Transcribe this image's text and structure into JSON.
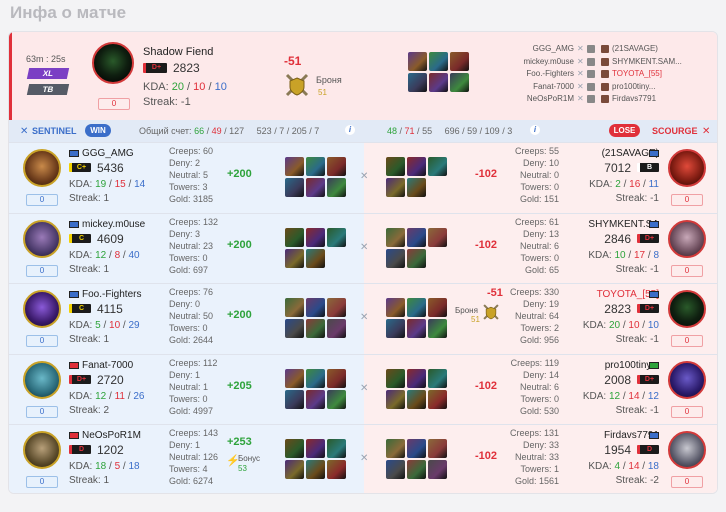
{
  "title": "Инфа о матче",
  "header": {
    "duration": "63m : 25s",
    "tag_xl": "XL",
    "tag_tb": "TB",
    "hero": "Shadow Fiend",
    "rank_badge": "D+",
    "mmr": "2823",
    "kda_label": "KDA:",
    "kda": [
      "20",
      "10",
      "10"
    ],
    "streak": "Streak: -1",
    "zero_badge": "0",
    "delta": "-51",
    "armor_label": "Броня",
    "armor_value": "51",
    "players_left": [
      "GGG_AMG",
      "mickey.m0use",
      "Foo.-Fighters",
      "Fanat-7000",
      "NeOsPoR1M"
    ],
    "players_right": [
      "(21SAVAGE)",
      "SHYMKENT.SAM...",
      "TOYOTA_[55]",
      "pro100tiny...",
      "Firdavs7791"
    ]
  },
  "summary": {
    "sentinel_label": "SENTINEL",
    "win_label": "WIN",
    "total_label": "Общий счет:",
    "left_kda": [
      "66",
      "49",
      "127"
    ],
    "left_totals": [
      "523",
      "7",
      "205",
      "7"
    ],
    "right_kda": [
      "48",
      "71",
      "55"
    ],
    "right_totals": [
      "696",
      "59",
      "109",
      "3"
    ],
    "lose_label": "LOSE",
    "scourge_label": "SCOURGE",
    "info_glyph": "i"
  },
  "rows": [
    {
      "left": {
        "name": "GGG_AMG",
        "rank": "C+",
        "mmr": "5436",
        "kda": [
          "19",
          "15",
          "14"
        ],
        "streak": "Streak: 1",
        "badge": "0",
        "stats": [
          "Creeps: 60",
          "Deny: 2",
          "Neutral: 5",
          "Towers: 3",
          "Gold: 3185"
        ],
        "delta": "+200"
      },
      "right": {
        "name": "(21SAVAGE)",
        "rank": "B",
        "mmr": "7012",
        "kda": [
          "2",
          "16",
          "11"
        ],
        "streak": "Streak: -1",
        "badge": "0",
        "stats": [
          "Creeps: 55",
          "Deny: 10",
          "Neutral: 0",
          "Towers: 0",
          "Gold: 151"
        ],
        "delta": "-102"
      }
    },
    {
      "left": {
        "name": "mickey.m0use",
        "rank": "C",
        "mmr": "4609",
        "kda": [
          "12",
          "8",
          "40"
        ],
        "streak": "Streak: 1",
        "badge": "0",
        "stats": [
          "Creeps: 132",
          "Deny: 3",
          "Neutral: 23",
          "Towers: 0",
          "Gold: 697"
        ],
        "delta": "+200"
      },
      "right": {
        "name": "SHYMKENT.SA",
        "rank": "D+",
        "mmr": "2846",
        "kda": [
          "10",
          "17",
          "8"
        ],
        "streak": "Streak: -1",
        "badge": "0",
        "stats": [
          "Creeps: 61",
          "Deny: 13",
          "Neutral: 6",
          "Towers: 0",
          "Gold: 65"
        ],
        "delta": "-102"
      }
    },
    {
      "left": {
        "name": "Foo.-Fighters",
        "rank": "C",
        "mmr": "4115",
        "kda": [
          "5",
          "10",
          "29"
        ],
        "streak": "Streak: 1",
        "badge": "0",
        "stats": [
          "Creeps: 76",
          "Deny: 0",
          "Neutral: 50",
          "Towers: 0",
          "Gold: 2644"
        ],
        "delta": "+200"
      },
      "right": {
        "name": "TOYOTA_[55]",
        "rank": "D+",
        "mmr": "2823",
        "kda": [
          "20",
          "10",
          "10"
        ],
        "streak": "Streak: -1",
        "badge": "0",
        "stats": [
          "Creeps: 330",
          "Deny: 19",
          "Neutral: 64",
          "Towers: 2",
          "Gold: 956"
        ],
        "delta": "-51",
        "armor_label": "Броня",
        "armor_value": "51"
      }
    },
    {
      "left": {
        "name": "Fanat-7000",
        "rank": "D+",
        "mmr": "2720",
        "kda": [
          "12",
          "11",
          "26"
        ],
        "streak": "Streak: 2",
        "badge": "0",
        "stats": [
          "Creeps: 112",
          "Deny: 1",
          "Neutral: 1",
          "Towers: 0",
          "Gold: 4997"
        ],
        "delta": "+205"
      },
      "right": {
        "name": "pro100tiny...",
        "rank": "D+",
        "mmr": "2008",
        "kda": [
          "12",
          "14",
          "12"
        ],
        "streak": "Streak: -1",
        "badge": "0",
        "stats": [
          "Creeps: 119",
          "Deny: 14",
          "Neutral: 6",
          "Towers: 0",
          "Gold: 530"
        ],
        "delta": "-102"
      }
    },
    {
      "left": {
        "name": "NeOsPoR1M",
        "rank": "D",
        "mmr": "1202",
        "kda": [
          "18",
          "5",
          "18"
        ],
        "streak": "Streak: 1",
        "badge": "0",
        "stats": [
          "Creeps: 143",
          "Deny: 1",
          "Neutral: 126",
          "Towers: 4",
          "Gold: 6274"
        ],
        "delta": "+253",
        "bonus_label": "Бонус",
        "bonus_value": "53"
      },
      "right": {
        "name": "Firdavs7791",
        "rank": "D",
        "mmr": "1954",
        "kda": [
          "4",
          "14",
          "18"
        ],
        "streak": "Streak: -2",
        "badge": "0",
        "stats": [
          "Creeps: 131",
          "Deny: 33",
          "Neutral: 33",
          "Towers: 1",
          "Gold: 1561"
        ],
        "delta": "-102"
      }
    }
  ],
  "colors": {
    "accent_red": "#e0303a",
    "accent_green": "#2ea33b",
    "accent_blue": "#3b6ec9"
  }
}
